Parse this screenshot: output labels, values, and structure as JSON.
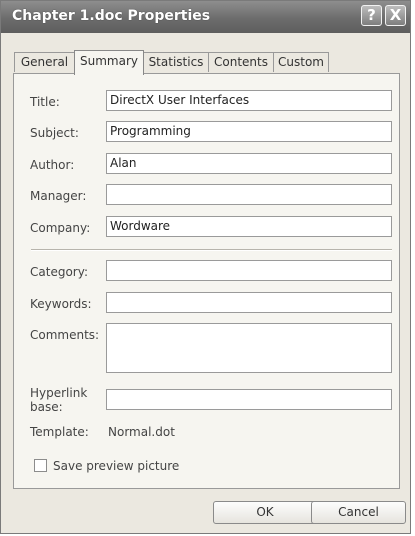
{
  "window": {
    "title": "Chapter 1.doc Properties",
    "help_button": "?",
    "close_button": "X"
  },
  "tabs": [
    {
      "label": "General",
      "active": false
    },
    {
      "label": "Summary",
      "active": true
    },
    {
      "label": "Statistics",
      "active": false
    },
    {
      "label": "Contents",
      "active": false
    },
    {
      "label": "Custom",
      "active": false
    }
  ],
  "fields": {
    "title": {
      "label": "Title:",
      "value": "DirectX User Interfaces"
    },
    "subject": {
      "label": "Subject:",
      "value": "Programming"
    },
    "author": {
      "label": "Author:",
      "value": "Alan"
    },
    "manager": {
      "label": "Manager:",
      "value": ""
    },
    "company": {
      "label": "Company:",
      "value": "Wordware"
    },
    "category": {
      "label": "Category:",
      "value": ""
    },
    "keywords": {
      "label": "Keywords:",
      "value": ""
    },
    "comments": {
      "label": "Comments:",
      "value": ""
    },
    "hyperlink_base": {
      "label_line1": "Hyperlink",
      "label_line2": "base:",
      "value": ""
    },
    "template": {
      "label": "Template:",
      "value": "Normal.dot"
    }
  },
  "save_preview": {
    "label": "Save preview picture",
    "checked": false
  },
  "buttons": {
    "ok": "OK",
    "cancel": "Cancel"
  }
}
